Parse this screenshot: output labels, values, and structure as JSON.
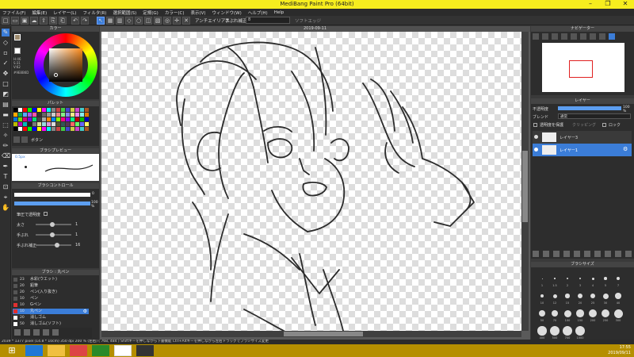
{
  "window": {
    "title": "MediBang Paint Pro (64bit)"
  },
  "menu": [
    "ファイル(F)",
    "編集(E)",
    "レイヤー(L)",
    "フィルタ(R)",
    "選択範囲(S)",
    "定規(G)",
    "カラー(C)",
    "表示(V)",
    "ウィンドウ(W)",
    "ヘルプ(H)",
    "Help"
  ],
  "toolbar": {
    "antialias_label": "アンチエイリアス",
    "correction_label": "手ぶれ補正",
    "correction_value": "8",
    "softedge_label": "ソフトエッジ"
  },
  "canvas_tab": "2019-09-11",
  "color_panel": {
    "title": "カラー",
    "hsv": "H:46\nS:31\nV:62",
    "hex": "#9E8B6D"
  },
  "palette_panel": {
    "title": "パレット",
    "label": "ボタン"
  },
  "brush_preview": {
    "title": "ブラシプレビュー",
    "size": "0.5px"
  },
  "brush_control": {
    "title": "ブラシコントロール",
    "size_value": "0",
    "opacity_value": "100 %",
    "pressure_label": "筆圧で透明度",
    "rows": [
      {
        "label": "太さ",
        "value": "1"
      },
      {
        "label": "手ぶれ",
        "value": "1"
      },
      {
        "label": "手ぶれ補正",
        "value": "16"
      }
    ]
  },
  "brush_list": {
    "title": "ブラシ : 丸ペン",
    "items": [
      {
        "size": "23",
        "name": "水彩(ウエット)"
      },
      {
        "size": "20",
        "name": "鉛筆"
      },
      {
        "size": "20",
        "name": "ペン(入り抜き)"
      },
      {
        "size": "10",
        "name": "ペン"
      },
      {
        "size": "10",
        "name": "Gペン"
      },
      {
        "size": "10",
        "name": "丸ペン"
      },
      {
        "size": "20",
        "name": "消しゴム"
      },
      {
        "size": "50",
        "name": "消しゴム(ソフト)"
      }
    ]
  },
  "navigator": {
    "title": "ナビゲーター"
  },
  "layer_panel": {
    "title": "レイヤー",
    "opacity_label": "不透明度",
    "opacity_value": "100 %",
    "blend_label": "ブレンド",
    "blend_value": "通常",
    "protect_label": "透明度を保護",
    "clipping_label": "クリッピング",
    "lock_label": "ロック",
    "layers": [
      {
        "name": "レイヤー3",
        "selected": false
      },
      {
        "name": "レイヤー1",
        "selected": true
      }
    ]
  },
  "brush_size_panel": {
    "title": "ブラシサイズ",
    "sizes": [
      "1",
      "1.5",
      "2",
      "3",
      "4",
      "5",
      "7",
      "10",
      "12",
      "15",
      "20",
      "25",
      "30",
      "40",
      "50",
      "70",
      "100",
      "150",
      "200",
      "250",
      "300",
      "400",
      "500",
      "700",
      "1000"
    ]
  },
  "status": {
    "text": "2039 * 1377 pixel (14.8 * 10cm) 350 dpi 200 % (左右) ( 768, 484 ) Shiftキーを押しながら下書機能 Ctrl+Altキーを押しながら左右ドラッグでブラシサイズ変更"
  },
  "taskbar": {
    "time": "17:55",
    "date": "2019/09/11"
  },
  "colors": {
    "accent": "#3b7dd8",
    "titlebar": "#f6ed1e",
    "taskbar": "#b58f00"
  }
}
